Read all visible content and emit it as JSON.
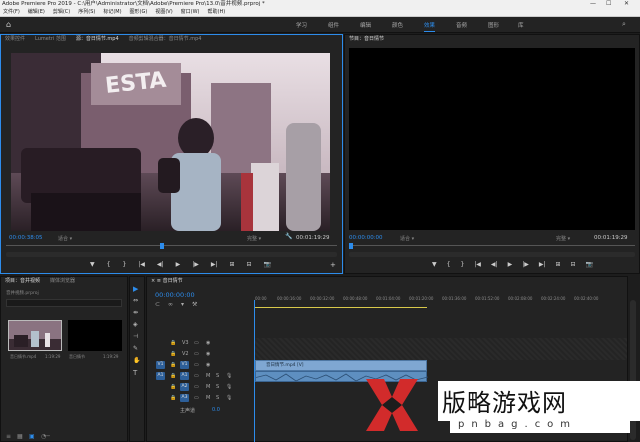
{
  "window": {
    "title": "Adobe Premiere Pro 2019 - C:\\用户\\Administrator\\文档\\Adobe\\Premiere Pro\\13.0\\音并视频.prproj *"
  },
  "menu": [
    "文件(F)",
    "编辑(E)",
    "剪辑(C)",
    "序列(S)",
    "标记(M)",
    "图形(G)",
    "视图(V)",
    "窗口(W)",
    "帮助(H)"
  ],
  "workspaces": [
    {
      "label": "学习"
    },
    {
      "label": "组件"
    },
    {
      "label": "编辑"
    },
    {
      "label": "颜色"
    },
    {
      "label": "效果",
      "active": true
    },
    {
      "label": "音频"
    },
    {
      "label": "图形"
    },
    {
      "label": "库"
    }
  ],
  "source_panel": {
    "tabs": [
      "效果控件",
      "Lumetri 范围",
      "源：音日情节.mp4",
      "音频剪辑混合器：音日情节.mp4"
    ],
    "active_tab": 2,
    "timecode": "00:00:38:05",
    "fit": "适合",
    "quality": "完整",
    "duration": "00:01:19:29",
    "video_sign": "ESTA"
  },
  "program_panel": {
    "tabs": [
      "节目：音日情节"
    ],
    "timecode": "00:00:00:00",
    "fit": "适合",
    "quality": "完整",
    "duration": "00:01:19:29"
  },
  "transport_glyphs": [
    "▼",
    "{",
    "}",
    "|◀",
    "◀|",
    "▶",
    "|▶",
    "▶|",
    "⊞",
    "⊟",
    "📷"
  ],
  "project_panel": {
    "tabs": [
      "项目：音并视频",
      "媒体浏览器"
    ],
    "project_file": "音并视频.prproj",
    "items": [
      {
        "name": "音日情节.mp4",
        "duration": "1:19:29"
      },
      {
        "name": "音日情节",
        "duration": "1:19:29"
      }
    ]
  },
  "timeline": {
    "tab": "音日情节",
    "timecode": "00:00:00:00",
    "ruler": [
      "00:00",
      "00:00:16:00",
      "00:00:32:00",
      "00:00:48:00",
      "00:01:04:00",
      "00:01:20:00",
      "00:01:36:00",
      "00:01:52:00",
      "00:02:08:00",
      "00:02:24:00",
      "00:02:40:00"
    ],
    "tracks": [
      {
        "src": "",
        "name": "V3"
      },
      {
        "src": "",
        "name": "V2"
      },
      {
        "src": "V1",
        "name": "V1"
      },
      {
        "src": "A1",
        "name": "A1",
        "audio": true
      },
      {
        "src": "",
        "name": "A2",
        "audio": true
      },
      {
        "src": "",
        "name": "A3",
        "audio": true
      }
    ],
    "master": {
      "label": "主声道",
      "value": "0.0"
    },
    "clip_label": "音日情节.mp4 [V]"
  },
  "tools": [
    "▶",
    "⇔",
    "⇹",
    "◈",
    "⊣",
    "✎",
    "✋",
    "T"
  ],
  "watermark": {
    "text": "版略游戏网",
    "domain": "pnbag.com",
    "color": "#d22b2b"
  }
}
